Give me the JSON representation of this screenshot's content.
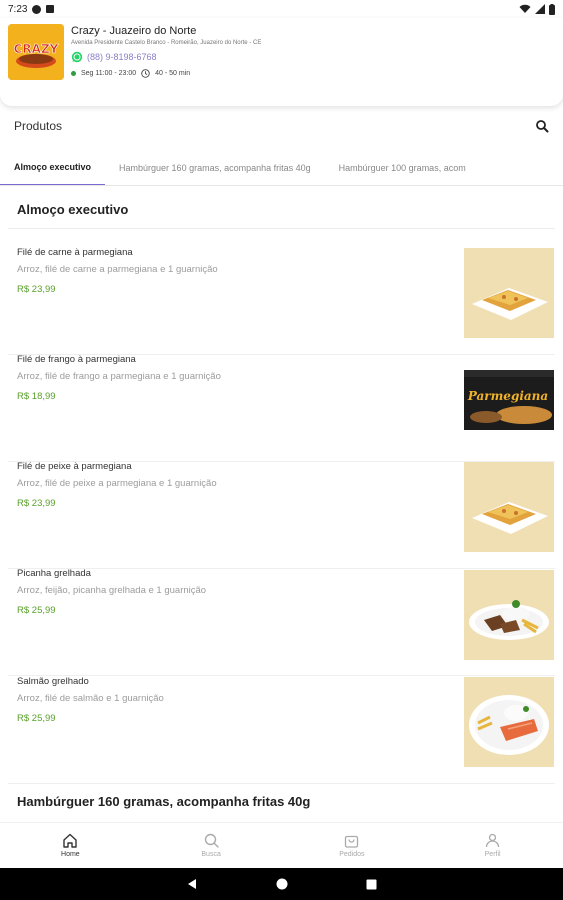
{
  "status_bar": {
    "time": "7:23"
  },
  "store": {
    "name": "Crazy - Juazeiro do Norte",
    "address": "Avenida Presidente Castelo Branco - Romeirão, Juazeiro do Norte - CE",
    "phone": "(88) 9-8198-6768",
    "hours": "Seg 11:00 - 23:00",
    "delivery_time": "40 - 50 min",
    "logo_text": "CRAZY"
  },
  "products": {
    "title": "Produtos"
  },
  "tabs": [
    {
      "label": "Almoço executivo",
      "active": true
    },
    {
      "label": "Hambúrguer 160 gramas, acompanha fritas 40g",
      "active": false
    },
    {
      "label": "Hambúrguer 100 gramas, acom",
      "active": false
    }
  ],
  "sections": [
    {
      "title": "Almoço executivo",
      "items": [
        {
          "name": "Filé de carne à parmegiana",
          "description": "Arroz, filé de carne a parmegiana e 1 guarnição",
          "price": "R$ 23,99"
        },
        {
          "name": "Filé de frango à parmegiana",
          "description": "Arroz, filé de frango a parmegiana e 1 guarnição",
          "price": "R$ 18,99",
          "image_text": "Parmegiana"
        },
        {
          "name": "Filé de peixe à parmegiana",
          "description": "Arroz, filé de peixe a parmegiana e 1 guarnição",
          "price": "R$ 23,99"
        },
        {
          "name": "Picanha grelhada",
          "description": "Arroz, feijão, picanha grelhada e 1 guarnição",
          "price": "R$ 25,99"
        },
        {
          "name": "Salmão grelhado",
          "description": "Arroz, filé de salmão e 1 guarnição",
          "price": "R$ 25,99"
        }
      ]
    },
    {
      "title": "Hambúrguer 160 gramas, acompanha fritas 40g"
    }
  ],
  "bottom_nav": [
    {
      "label": "Home",
      "icon": "home-icon",
      "active": true
    },
    {
      "label": "Busca",
      "icon": "search-icon",
      "active": false
    },
    {
      "label": "Pedidos",
      "icon": "bag-icon",
      "active": false
    },
    {
      "label": "Perfil",
      "icon": "profile-icon",
      "active": false
    }
  ],
  "colors": {
    "accent": "#7b6ad0",
    "price_green": "#5aa02c",
    "phone_purple": "#8a7ec9",
    "whatsapp_green": "#25d366"
  }
}
